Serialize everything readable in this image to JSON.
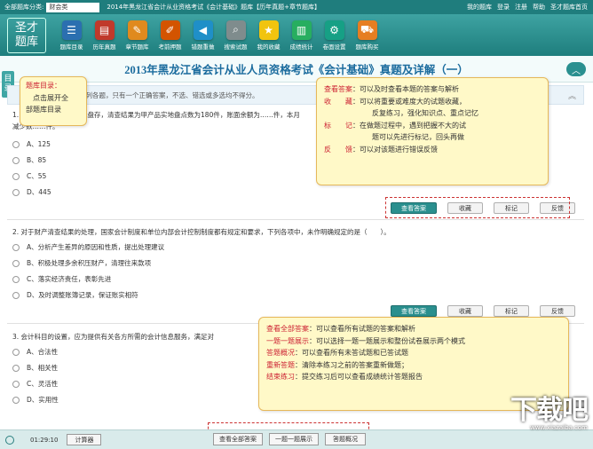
{
  "topbar": {
    "category_label": "全部题库分类:",
    "category_value": "财会类",
    "path": "2014年黑龙江省会计从业资格考试《会计基础》题库【历年真题+章节题库】",
    "links": [
      "我的题库",
      "登录",
      "注册",
      "帮助",
      "圣才题库首页"
    ]
  },
  "logo": "圣才题库",
  "toolbar": [
    {
      "label": "题库目录",
      "icon": "book-list-icon",
      "color": "#2b6fb0"
    },
    {
      "label": "历年真题",
      "icon": "papers-icon",
      "color": "#c0392b"
    },
    {
      "label": "章节题库",
      "icon": "notebook-icon",
      "color": "#e08a1e"
    },
    {
      "label": "考前押题",
      "icon": "pencil-icon",
      "color": "#d35400"
    },
    {
      "label": "错题重做",
      "icon": "back-arrow-icon",
      "color": "#1f8fc8"
    },
    {
      "label": "搜索试题",
      "icon": "magnifier-icon",
      "color": "#7f8c8d"
    },
    {
      "label": "我的收藏",
      "icon": "star-icon",
      "color": "#f1c40f"
    },
    {
      "label": "成绩统计",
      "icon": "chart-icon",
      "color": "#27ae60"
    },
    {
      "label": "卷面设置",
      "icon": "settings-icon",
      "color": "#16a085"
    },
    {
      "label": "题库购买",
      "icon": "cart-icon",
      "color": "#e67e22"
    }
  ],
  "page_title": "2013年黑龙江省会计从业人员资格考试《会计基础》真题及详解（一）",
  "side_tab": "目录",
  "section_instruction": "一、单项选择题（下列各题，只有一个正确答案，不选、错选或多选均不得分。",
  "questions": [
    {
      "stem": "1. 某公司甲产品进行实地盘存，清查结果为甲产品实地盘点数为180件，账面余额为……件，本月",
      "stem2": "减少数……件。",
      "options": [
        "A、125",
        "B、85",
        "C、55",
        "D、445"
      ]
    },
    {
      "stem": "2. 对于财产清查结果的处理，国家会计制度和单位内部会计控制制度都有规定和要求，下列各项中，未作明确规定的是（　　）。",
      "options": [
        "A、分析产生差异的原因和性质，提出处理建议",
        "B、积极处理多余积压财产，清理往来款项",
        "C、落实经济责任，表彰先进",
        "D、及时调整账簿记录，保证账实相符"
      ]
    },
    {
      "stem": "3. 会计科目的设置，应为提供有关各方所需的会计信息服务，满足对",
      "options": [
        "A、合法性",
        "B、相关性",
        "C、灵活性",
        "D、实用性"
      ]
    }
  ],
  "question_buttons": [
    "查看答案",
    "收藏",
    "标记",
    "反馈"
  ],
  "callout_catalog": {
    "title": "题库目录：",
    "lines": [
      "点击展开全",
      "部题库目录"
    ]
  },
  "callout_answer": [
    {
      "key": "查看答案",
      "text": "：可以及时查看本题的答案与解析"
    },
    {
      "key": "收　　藏",
      "text": "：可以将重要或难度大的试题收藏，"
    },
    {
      "key": "",
      "text": "反复练习，强化知识点、重点记忆"
    },
    {
      "key": "标　　记",
      "text": "：在做题过程中，遇到把握不大的试"
    },
    {
      "key": "",
      "text": "题可以先进行标记，回头再做"
    },
    {
      "key": "反　　馈",
      "text": "：可以对该题进行错误反馈"
    }
  ],
  "callout_bottom": [
    {
      "key": "查看全部答案",
      "text": "：可以查看所有试题的答案和解析"
    },
    {
      "key": "一题一题展示",
      "text": "：可以选择一题一题展示和整份试卷展示两个模式"
    },
    {
      "key": "答题概况",
      "text": "：可以查看所有未答试题和已答试题"
    },
    {
      "key": "重新答题",
      "text": "：清除本练习之前的答案重新做题；"
    },
    {
      "key": "结束练习",
      "text": "：提交练习后可以查看成绩统计答题报告"
    }
  ],
  "status": {
    "time": "01:29:10",
    "calculator": "计算器",
    "buttons": [
      "查看全部答案",
      "一题一题展示",
      "答题概况"
    ]
  },
  "watermark": {
    "big": "下载吧",
    "small": "www.xiazaiba.com"
  }
}
